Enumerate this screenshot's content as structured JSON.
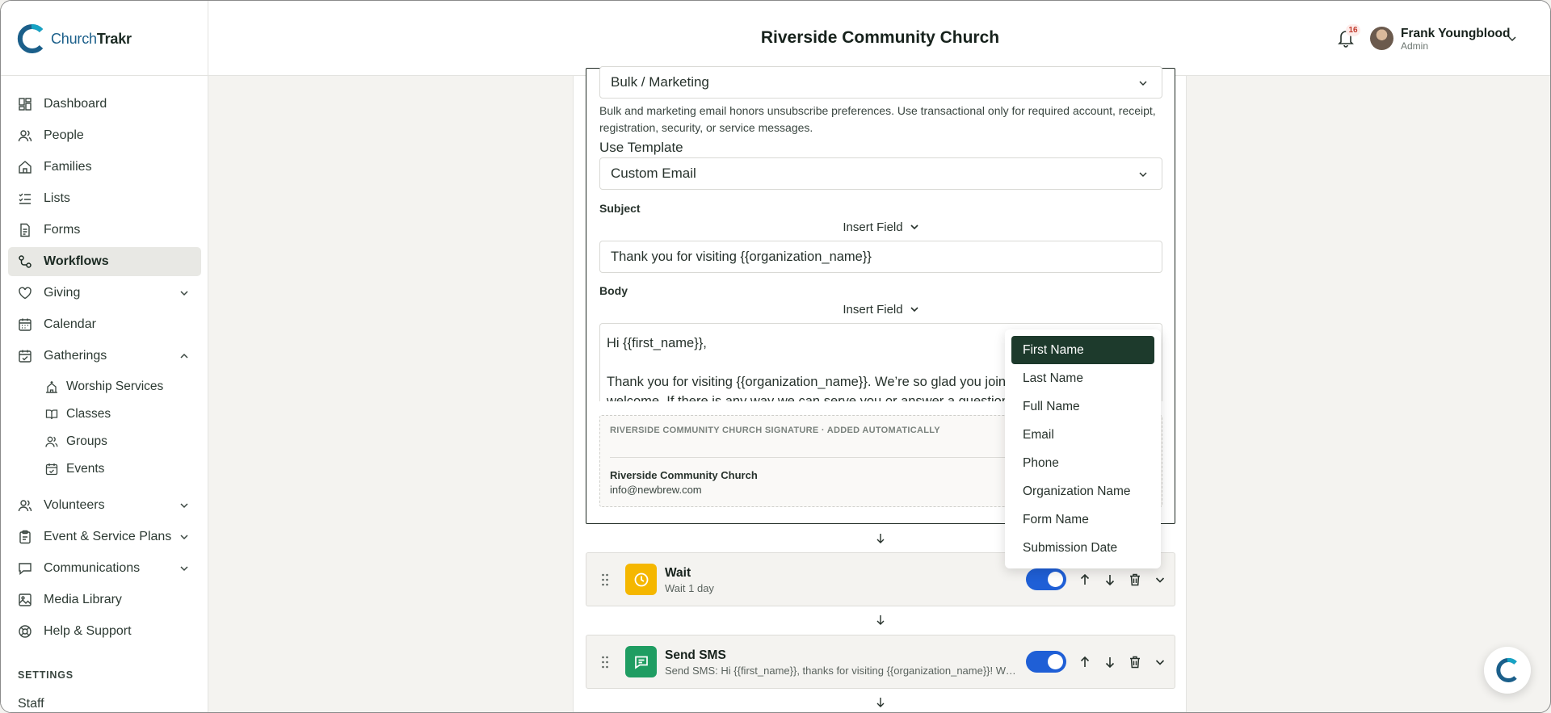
{
  "app": {
    "logo_main": "Church",
    "logo_bold": "Trakr"
  },
  "sidebar": {
    "items": [
      {
        "label": "Dashboard",
        "icon": "dashboard-icon"
      },
      {
        "label": "People",
        "icon": "people-icon"
      },
      {
        "label": "Families",
        "icon": "home-icon"
      },
      {
        "label": "Lists",
        "icon": "list-icon"
      },
      {
        "label": "Forms",
        "icon": "form-icon"
      },
      {
        "label": "Workflows",
        "icon": "workflow-icon",
        "active": true
      },
      {
        "label": "Giving",
        "icon": "heart-icon"
      },
      {
        "label": "Calendar",
        "icon": "calendar-icon"
      },
      {
        "label": "Gatherings",
        "icon": "calendar-check-icon"
      }
    ],
    "gatherings_children": [
      {
        "label": "Worship Services",
        "icon": "church-icon"
      },
      {
        "label": "Classes",
        "icon": "book-icon"
      },
      {
        "label": "Groups",
        "icon": "people-icon"
      },
      {
        "label": "Events",
        "icon": "calendar-check-icon"
      }
    ],
    "items_after": [
      {
        "label": "Volunteers",
        "icon": "people-icon"
      },
      {
        "label": "Event & Service Plans",
        "icon": "clipboard-icon"
      },
      {
        "label": "Communications",
        "icon": "chat-icon"
      },
      {
        "label": "Media Library",
        "icon": "image-icon"
      },
      {
        "label": "Help & Support",
        "icon": "help-icon"
      }
    ],
    "settings_label": "SETTINGS",
    "staff_label": "Staff"
  },
  "header": {
    "title": "Riverside Community Church",
    "notification_count": "16",
    "user_name": "Frank Youngblood",
    "user_role": "Admin"
  },
  "email_step": {
    "email_type_value": "Bulk / Marketing",
    "email_type_help": "Bulk and marketing email honors unsubscribe preferences. Use transactional only for required account, receipt, registration, security, or service messages.",
    "template_label": "Use Template",
    "template_value": "Custom Email",
    "subject_label": "Subject",
    "insert_field_label": "Insert Field",
    "subject_value": "Thank you for visiting {{organization_name}}",
    "body_label": "Body",
    "body_line1": "Hi {{first_name}},",
    "body_line2": "Thank you for visiting {{organization_name}}. We’re so glad you joined",
    "body_line3": "welcome. If there is any way we can serve you or answer a question,",
    "signature_heading": "RIVERSIDE COMMUNITY CHURCH SIGNATURE · ADDED AUTOMATICALLY",
    "signature_name": "Riverside Community Church",
    "signature_email": "info@newbrew.com"
  },
  "insert_field_menu": {
    "options": [
      "First Name",
      "Last Name",
      "Full Name",
      "Email",
      "Phone",
      "Organization Name",
      "Form Name",
      "Submission Date"
    ],
    "selected": "First Name"
  },
  "steps": [
    {
      "title": "Wait",
      "subtitle": "Wait 1 day",
      "icon": "clock-icon",
      "color": "#f5b700",
      "enabled": true
    },
    {
      "title": "Send SMS",
      "subtitle": "Send SMS: Hi {{first_name}}, thanks for visiting {{organization_name}}! We’re so glad you came.",
      "icon": "message-icon",
      "color": "#1f9d62",
      "enabled": true
    }
  ],
  "colors": {
    "accent_dark": "#1d3a2c",
    "toggle_blue": "#1f5fd6",
    "brand_blue": "#1b5f8a"
  }
}
